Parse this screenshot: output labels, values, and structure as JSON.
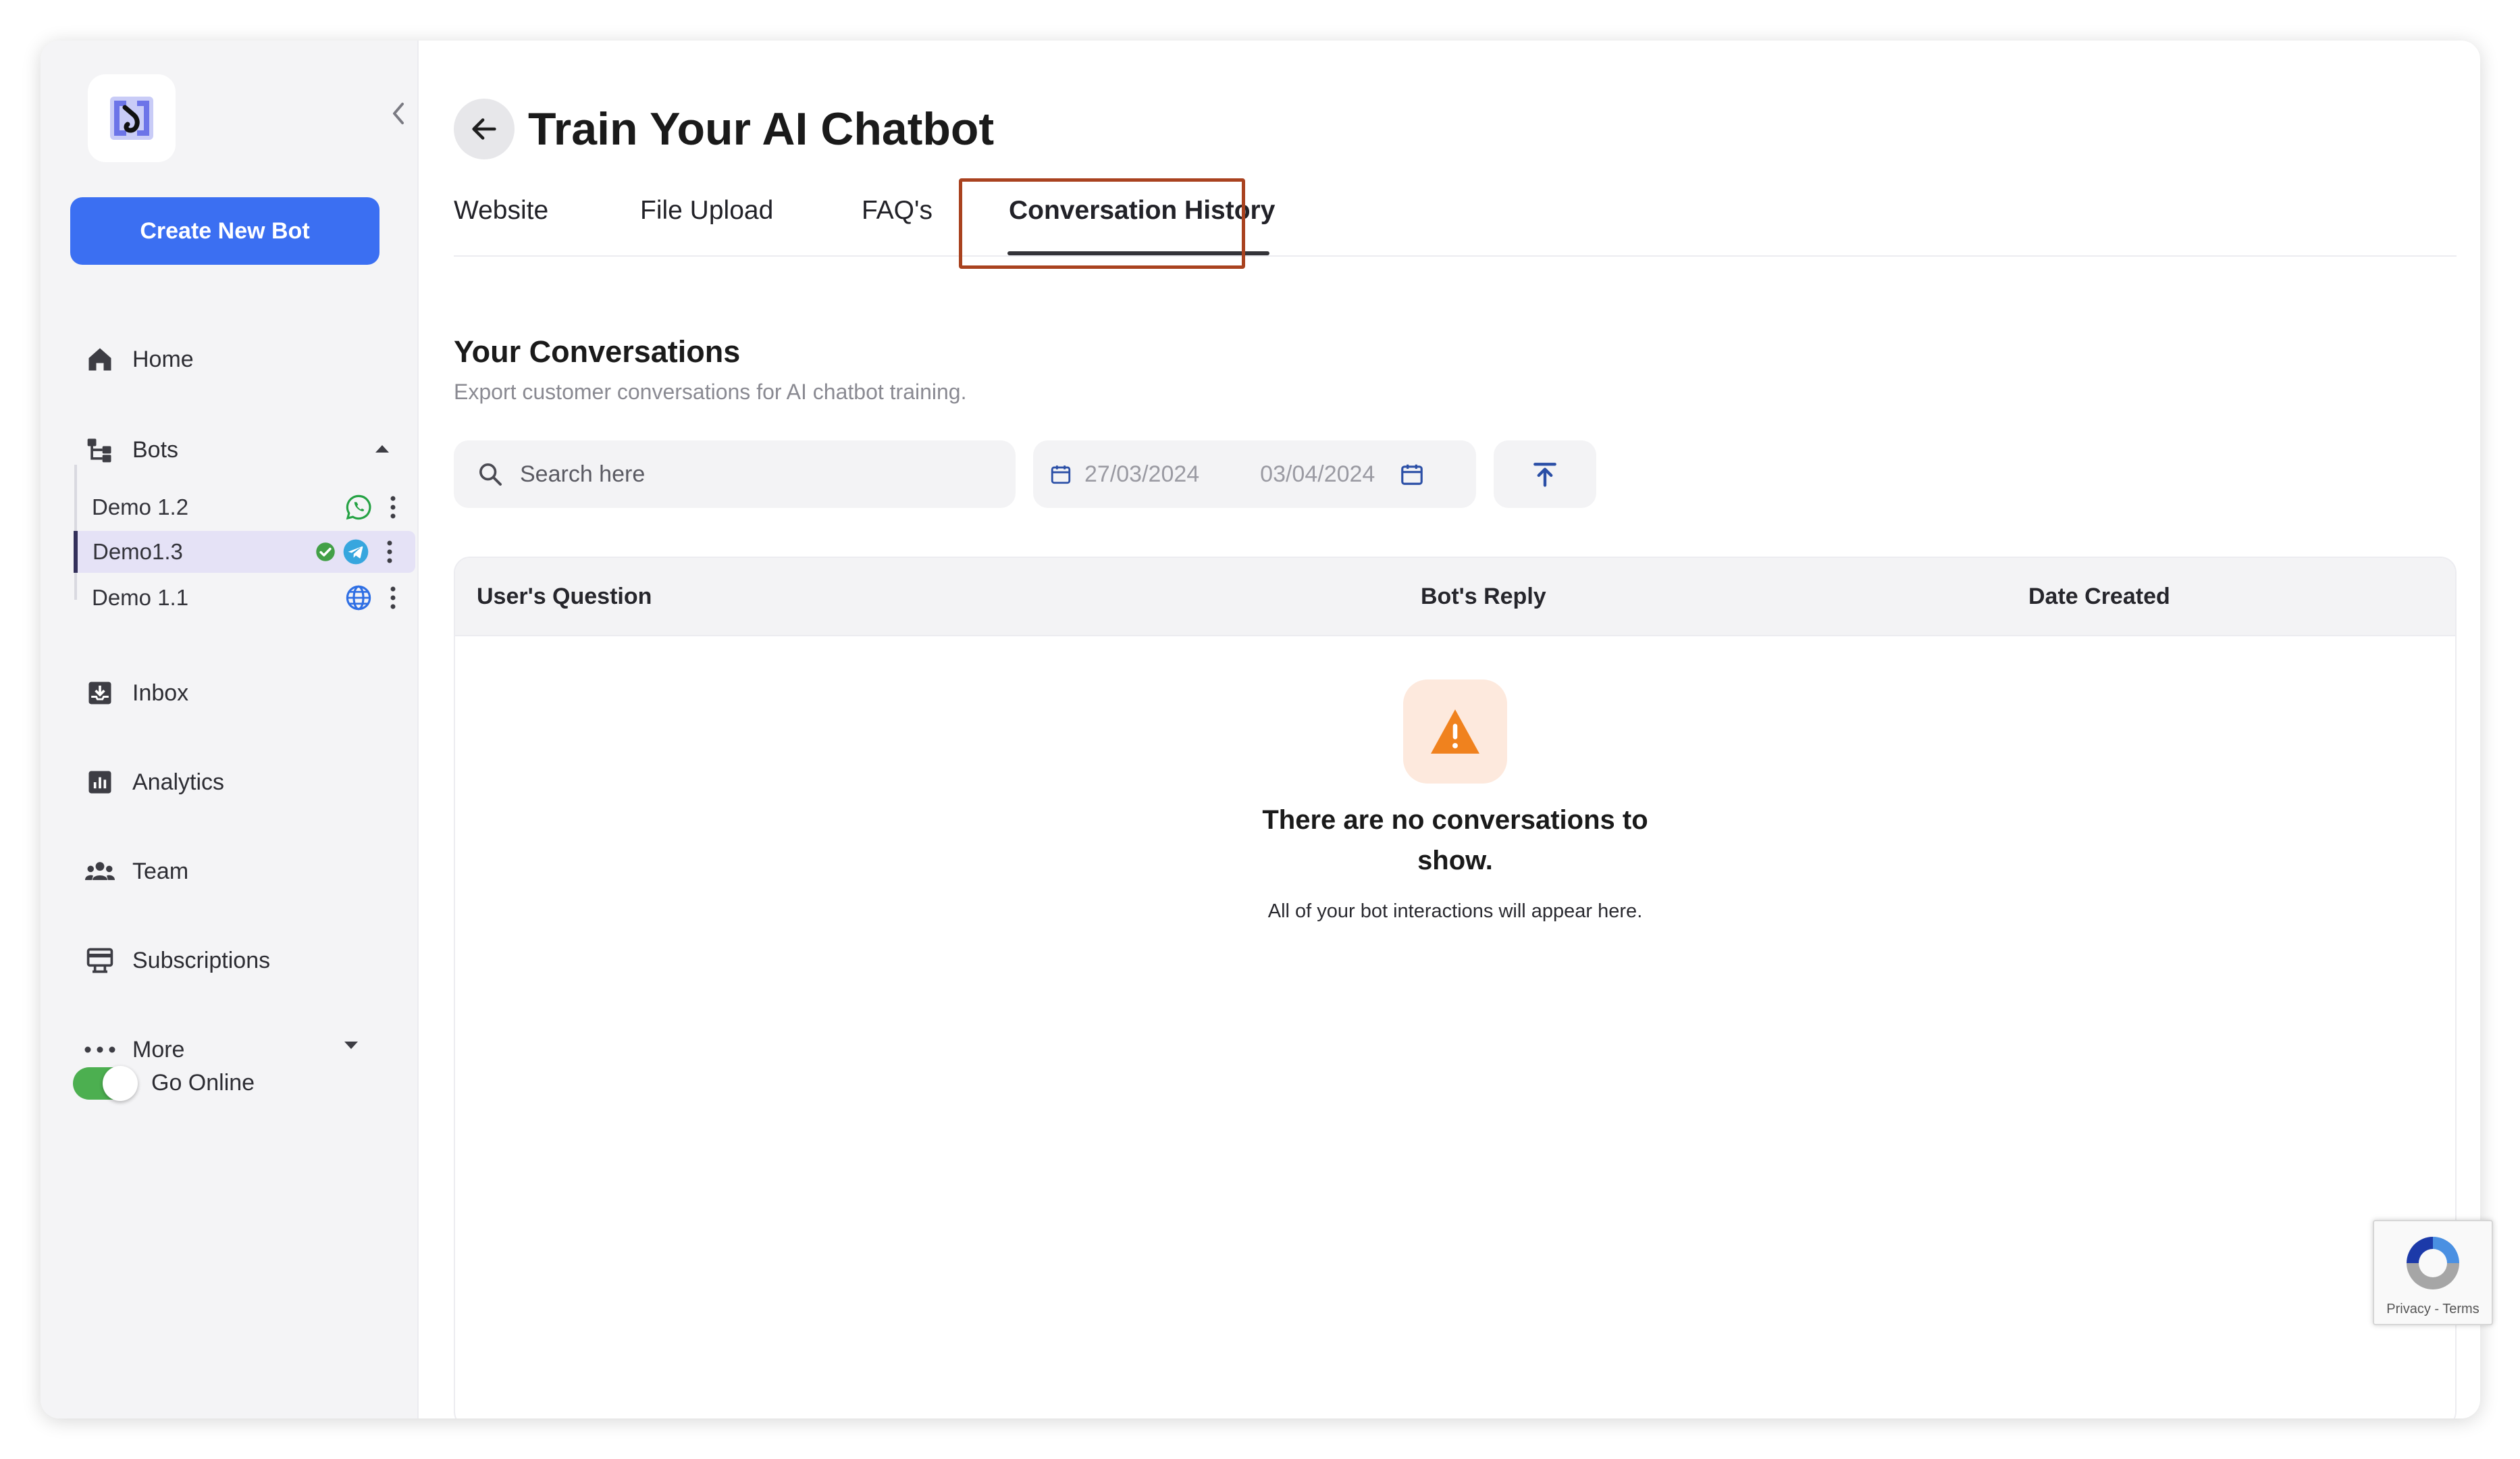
{
  "sidebar": {
    "create_button": "Create New Bot",
    "nav": {
      "home": "Home",
      "bots": "Bots",
      "inbox": "Inbox",
      "analytics": "Analytics",
      "team": "Team",
      "subscriptions": "Subscriptions",
      "more": "More"
    },
    "bots": [
      {
        "name": "Demo 1.2",
        "channel": "whatsapp-icon"
      },
      {
        "name": "Demo1.3",
        "channel": "telegram-icon",
        "status": "check-icon"
      },
      {
        "name": "Demo 1.1",
        "channel": "globe-icon"
      }
    ],
    "go_online_label": "Go Online",
    "go_online": true
  },
  "main": {
    "title": "Train Your AI Chatbot",
    "tabs": [
      "Website",
      "File Upload",
      "FAQ's",
      "Conversation History"
    ],
    "active_tab": "Conversation History",
    "section_title": "Your Conversations",
    "section_subtitle": "Export customer conversations for AI chatbot training.",
    "search_placeholder": "Search here",
    "date_from": "27/03/2024",
    "date_to": "03/04/2024",
    "table": {
      "columns": [
        "User's Question",
        "Bot's Reply",
        "Date Created"
      ],
      "empty_title": "There are no conversations to show.",
      "empty_subtitle": "All of your bot interactions will appear here."
    }
  },
  "recaptcha": {
    "label": "Privacy - Terms"
  },
  "colors": {
    "primary": "#3b6ff2",
    "highlight": "#a9421f",
    "warning": "#f0821e",
    "toggle_on": "#4caf50"
  }
}
